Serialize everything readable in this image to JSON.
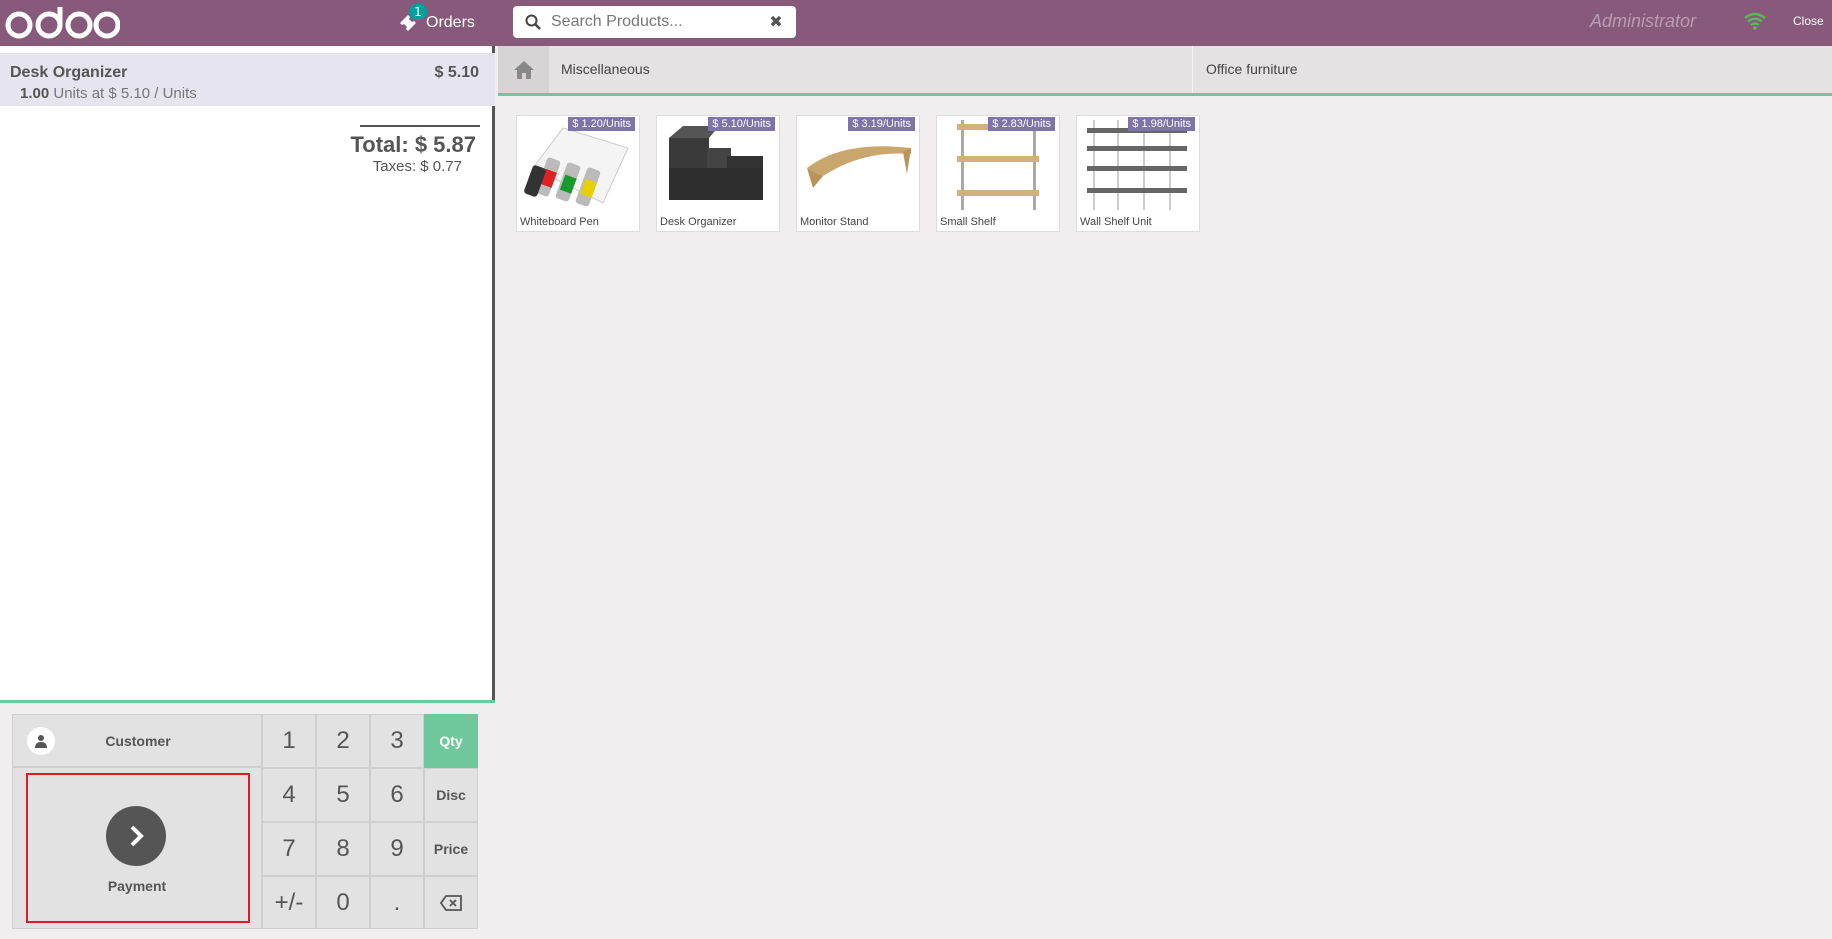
{
  "topbar": {
    "logo_text": "odoo",
    "orders_label": "Orders",
    "orders_badge": "1",
    "search_placeholder": "Search Products...",
    "user_name": "Administrator",
    "close_label": "Close",
    "accent_color": "#875a7b"
  },
  "order": {
    "line": {
      "name": "Desk Organizer",
      "price": "$ 5.10",
      "qty": "1.00",
      "detail": "Units at $ 5.10 / Units"
    },
    "total": "Total: $ 5.87",
    "taxes": "Taxes: $ 0.77"
  },
  "pad": {
    "customer_label": "Customer",
    "payment_label": "Payment",
    "keys": [
      "1",
      "2",
      "3",
      "Qty",
      "4",
      "5",
      "6",
      "Disc",
      "7",
      "8",
      "9",
      "Price",
      "+/-",
      "0",
      "."
    ],
    "active_mode": "Qty"
  },
  "categories": {
    "home_icon": "home-icon",
    "items": [
      "Miscellaneous",
      "Office furniture"
    ]
  },
  "products": [
    {
      "name": "Whiteboard Pen",
      "price": "$ 1.20/Units"
    },
    {
      "name": "Desk Organizer",
      "price": "$ 5.10/Units"
    },
    {
      "name": "Monitor Stand",
      "price": "$ 3.19/Units"
    },
    {
      "name": "Small Shelf",
      "price": "$ 2.83/Units"
    },
    {
      "name": "Wall Shelf Unit",
      "price": "$ 1.98/Units"
    }
  ]
}
